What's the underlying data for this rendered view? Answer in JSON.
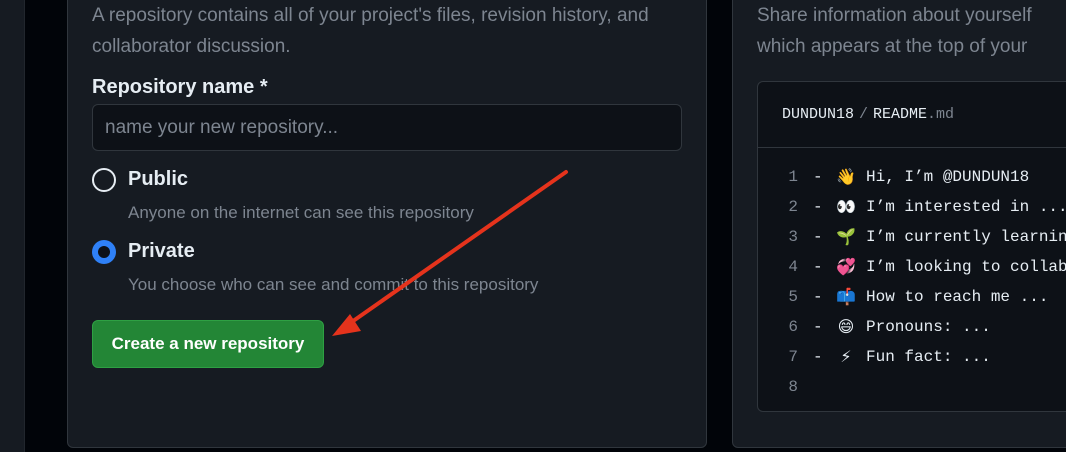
{
  "create_repo": {
    "description": "A repository contains all of your project's files, revision history, and collaborator discussion.",
    "name_label": "Repository name *",
    "name_placeholder": "name your new repository...",
    "public_title": "Public",
    "public_desc": "Anyone on the internet can see this repository",
    "private_title": "Private",
    "private_desc": "You choose who can see and commit to this repository",
    "create_button": "Create a new repository"
  },
  "profile_readme": {
    "description_line1": "Share information about yourself",
    "description_line2": "which appears at the top of your",
    "repo_user": "DUNDUN18",
    "separator": "/",
    "file_base": "README",
    "file_ext": ".md",
    "lines": [
      {
        "num": "1",
        "dash": "-",
        "emoji": "👋",
        "text": "Hi, I’m @DUNDUN18"
      },
      {
        "num": "2",
        "dash": "-",
        "emoji": "👀",
        "text": "I’m interested in ..."
      },
      {
        "num": "3",
        "dash": "-",
        "emoji": "🌱",
        "text": "I’m currently learning"
      },
      {
        "num": "4",
        "dash": "-",
        "emoji": "💞",
        "text": "I’m looking to collab"
      },
      {
        "num": "5",
        "dash": "-",
        "emoji": "📫",
        "text": "How to reach me ..."
      },
      {
        "num": "6",
        "dash": "-",
        "emoji": "😄",
        "text": "Pronouns: ..."
      },
      {
        "num": "7",
        "dash": "-",
        "emoji": "⚡",
        "text": "Fun fact: ..."
      },
      {
        "num": "8",
        "dash": "",
        "emoji": "",
        "text": ""
      }
    ]
  },
  "colors": {
    "accent_green": "#238636",
    "radio_blue": "#2f81f7",
    "annotation_arrow": "#e5331c"
  }
}
